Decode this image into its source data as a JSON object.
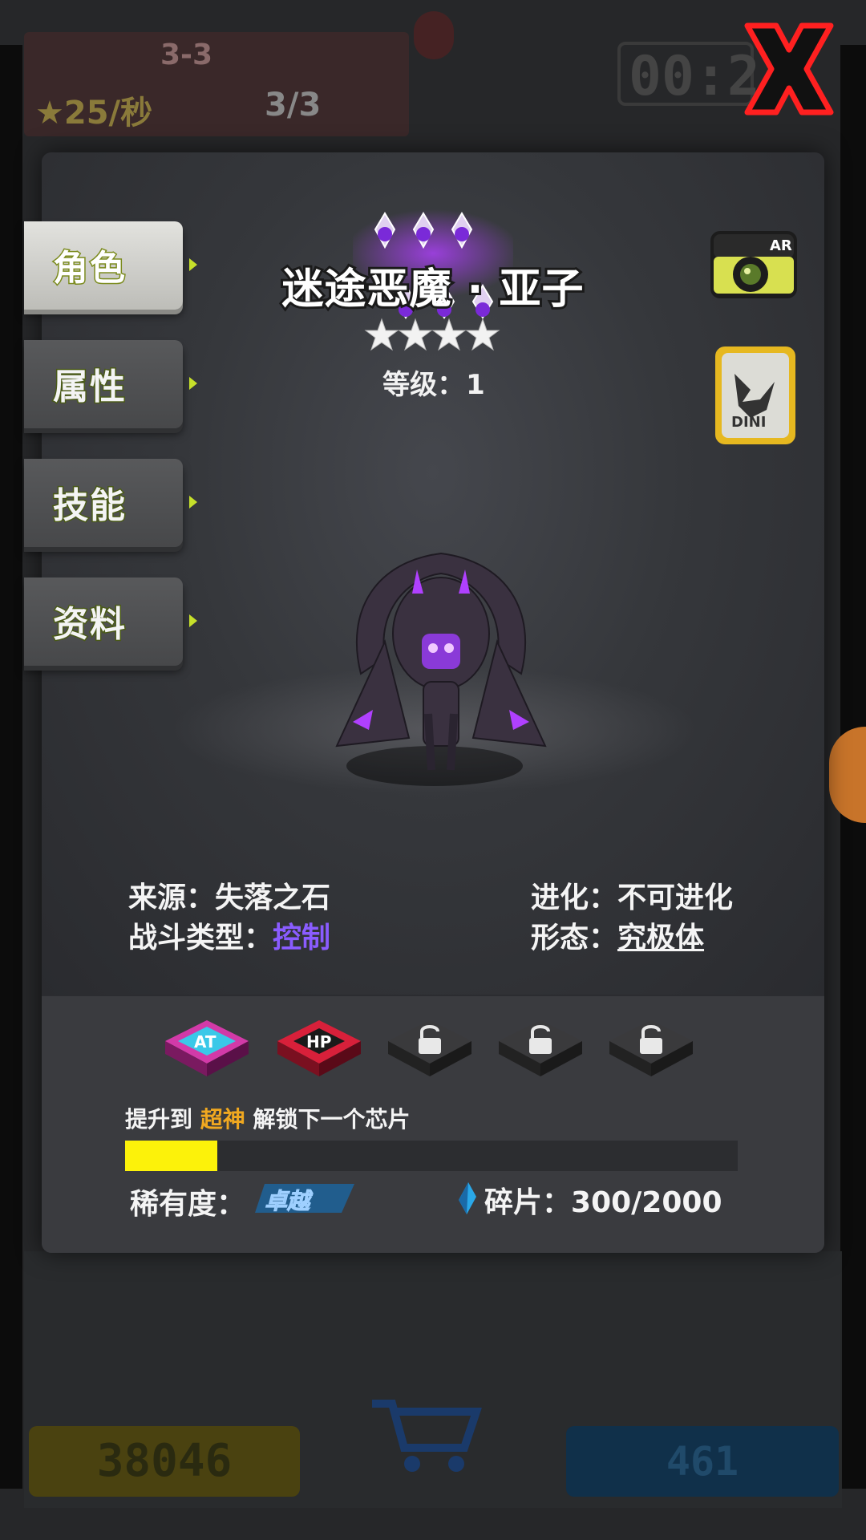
{
  "background": {
    "stage": "3-3",
    "rate": "25/秒",
    "count": "3/3",
    "timer": "00:2",
    "coins": "38046",
    "gems": "461"
  },
  "tabs": [
    {
      "label": "角色",
      "active": true
    },
    {
      "label": "属性",
      "active": false
    },
    {
      "label": "技能",
      "active": false
    },
    {
      "label": "资料",
      "active": false
    }
  ],
  "character": {
    "name": "迷途恶魔 · 亚子",
    "stars": 4,
    "level_label": "等级：",
    "level": "1"
  },
  "info": {
    "source_label": "来源：",
    "source": "失落之石",
    "battle_type_label": "战斗类型：",
    "battle_type": "控制",
    "evolution_label": "进化：",
    "evolution": "不可进化",
    "form_label": "形态：",
    "form": "究极体"
  },
  "chips": [
    {
      "name": "AT",
      "state": "unlocked",
      "color": "#d23aa8"
    },
    {
      "name": "HP",
      "state": "unlocked",
      "color": "#d8203a"
    },
    {
      "name": "locked",
      "state": "locked"
    },
    {
      "name": "locked",
      "state": "locked"
    },
    {
      "name": "locked",
      "state": "locked"
    }
  ],
  "unlock": {
    "prefix": "提升到 ",
    "highlight": "超神",
    "suffix": " 解锁下一个芯片",
    "progress": 0.15
  },
  "rarity": {
    "label": "稀有度：",
    "value": "卓越"
  },
  "shards": {
    "label": "碎片：",
    "value": "300/2000"
  },
  "icons": {
    "ar": "AR",
    "card": "DINI"
  },
  "colors": {
    "accent_green": "#c6e02a",
    "purple": "#8a5cff",
    "progress": "#fcf20a",
    "close_red": "#ff2020"
  }
}
